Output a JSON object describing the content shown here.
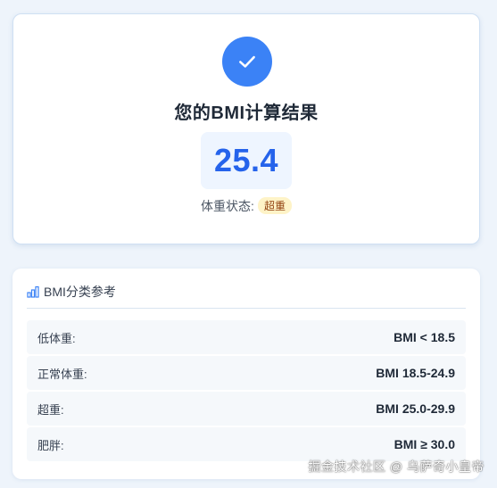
{
  "result": {
    "title": "您的BMI计算结果",
    "value": "25.4",
    "status_label": "体重状态:",
    "status_badge": "超重"
  },
  "reference": {
    "title": "BMI分类参考",
    "rows": [
      {
        "label": "低体重:",
        "range": "BMI < 18.5"
      },
      {
        "label": "正常体重:",
        "range": "BMI 18.5-24.9"
      },
      {
        "label": "超重:",
        "range": "BMI 25.0-29.9"
      },
      {
        "label": "肥胖:",
        "range": "BMI ≥ 30.0"
      }
    ]
  },
  "watermark": "掘金技术社区 @ 乌萨奇小皇帝",
  "colors": {
    "accent": "#3b82f6",
    "value": "#2563eb",
    "badge_bg": "#fef3c7",
    "badge_text": "#92400e"
  }
}
